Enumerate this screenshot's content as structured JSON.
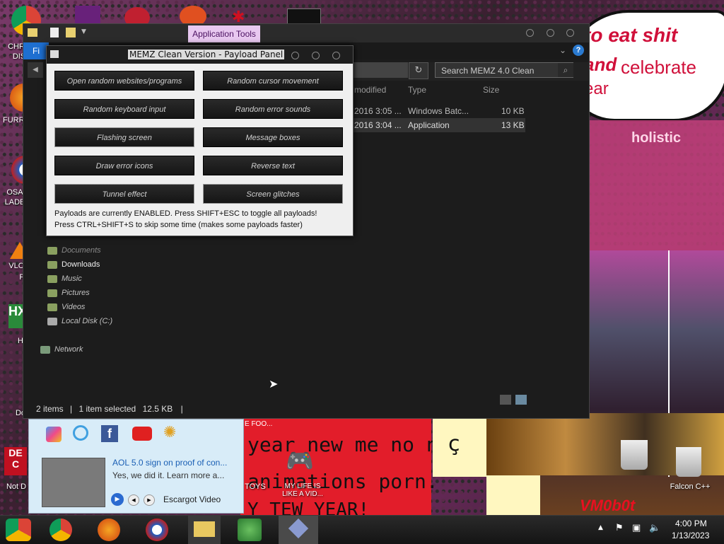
{
  "explorer": {
    "ribbon_tab": "Application Tools",
    "file_tab": "Fi",
    "search_placeholder": "Search MEMZ 4.0 Clean",
    "columns": [
      "modified",
      "Type",
      "Size"
    ],
    "rows": [
      {
        "modified": "2016 3:05 ...",
        "type": "Windows Batc...",
        "size": "10 KB"
      },
      {
        "modified": "2016 3:04 ...",
        "type": "Application",
        "size": "13 KB"
      }
    ],
    "nav": [
      "Documents",
      "Downloads",
      "Music",
      "Pictures",
      "Videos",
      "Local Disk (C:)",
      "Network"
    ],
    "status": {
      "items": "2 items",
      "selected": "1 item selected",
      "size": "12.5 KB"
    }
  },
  "memz": {
    "title": "MEMZ Clean Version - Payload Panel",
    "buttons": [
      "Open random websites/programs",
      "Random cursor movement",
      "Random keyboard input",
      "Random error sounds",
      "Flashing screen",
      "Message boxes",
      "Draw error icons",
      "Reverse text",
      "Tunnel effect",
      "Screen glitches"
    ],
    "note1": "Payloads are currently ENABLED. Press SHIFT+ESC to toggle all payloads!",
    "note2": "Press CTRL+SHIFT+S to skip some time (makes some payloads faster)"
  },
  "desktop": {
    "left_labels": [
      "CHR",
      "DIS",
      "FURR",
      "OSA",
      "LADE",
      "VLC",
      "P",
      "H",
      "Do",
      "DE",
      "C",
      "Not D"
    ],
    "speech": [
      "to eat shit",
      "and",
      "celebrate",
      "ear"
    ],
    "pink_text": "holistic",
    "red_small": "E FOO...",
    "red_lines": [
      "year new me no n",
      "animations porn.",
      "Y TEW YEAR!"
    ],
    "vm_text": "VM0b0t",
    "toys_label": "TOYS",
    "game_label": "MY LIFE IS LIKE A VID...",
    "falcon_label": "Falcon C++"
  },
  "widget": {
    "video_title": "AOL 5.0 sign on proof of con...",
    "video_desc": "Yes, we did it. Learn more a...",
    "player_name": "Escargot Video"
  },
  "taskbar": {
    "time": "4:00 PM",
    "date": "1/13/2023"
  }
}
